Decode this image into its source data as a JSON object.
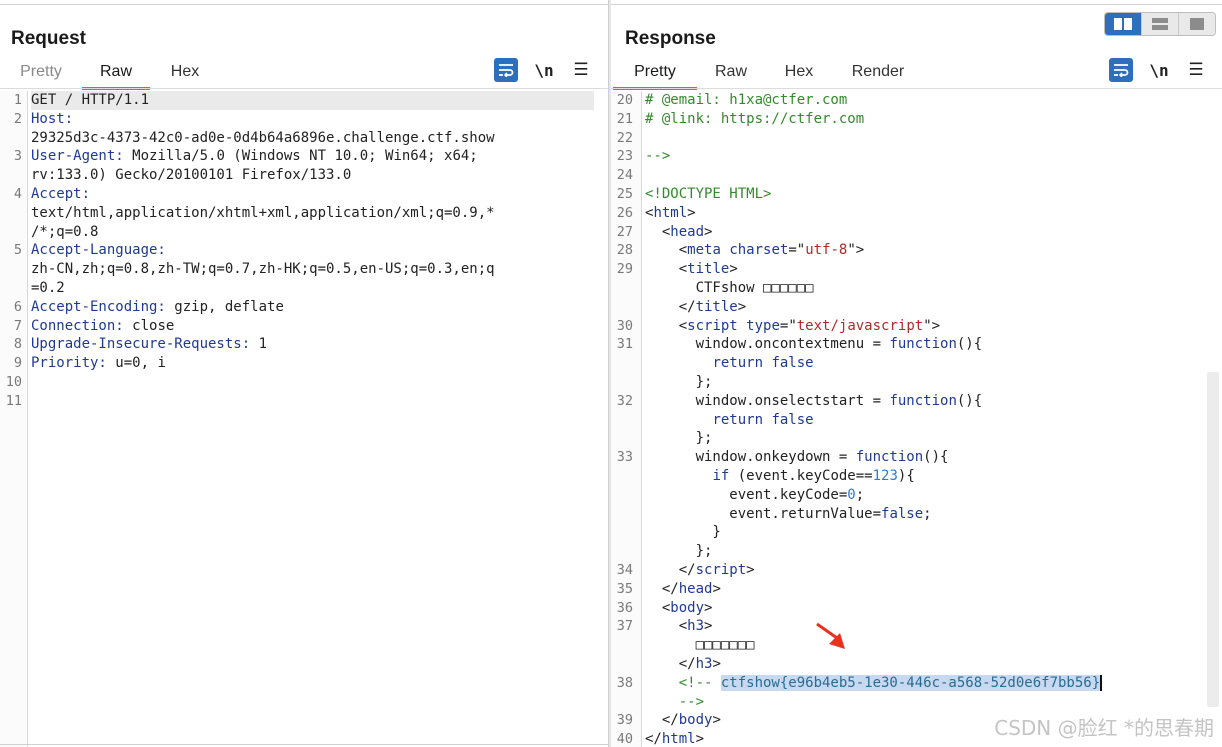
{
  "request": {
    "title": "Request",
    "tabs": [
      "Pretty",
      "Raw",
      "Hex"
    ],
    "active_tab": "Raw",
    "tools": {
      "wrap": "word-wrap-icon",
      "newline_label": "\\n",
      "menu": "menu-icon"
    },
    "lines": [
      {
        "n": "1",
        "segs": [
          {
            "t": "GET / HTTP/1.1",
            "c": ""
          }
        ]
      },
      {
        "n": "2",
        "segs": [
          {
            "t": "Host:",
            "c": "hdr"
          }
        ]
      },
      {
        "n": "",
        "segs": [
          {
            "t": "29325d3c-4373-42c0-ad0e-0d4b64a6896e.challenge.ctf.show",
            "c": ""
          }
        ]
      },
      {
        "n": "3",
        "segs": [
          {
            "t": "User-Agent: ",
            "c": "hdr"
          },
          {
            "t": "Mozilla/5.0 (Windows NT 10.0; Win64; x64;",
            "c": ""
          }
        ]
      },
      {
        "n": "",
        "segs": [
          {
            "t": "rv:133.0) Gecko/20100101 Firefox/133.0",
            "c": ""
          }
        ]
      },
      {
        "n": "4",
        "segs": [
          {
            "t": "Accept:",
            "c": "hdr"
          }
        ]
      },
      {
        "n": "",
        "segs": [
          {
            "t": "text/html,application/xhtml+xml,application/xml;q=0.9,*",
            "c": ""
          }
        ]
      },
      {
        "n": "",
        "segs": [
          {
            "t": "/*;q=0.8",
            "c": ""
          }
        ]
      },
      {
        "n": "5",
        "segs": [
          {
            "t": "Accept-Language:",
            "c": "hdr"
          }
        ]
      },
      {
        "n": "",
        "segs": [
          {
            "t": "zh-CN,zh;q=0.8,zh-TW;q=0.7,zh-HK;q=0.5,en-US;q=0.3,en;q",
            "c": ""
          }
        ]
      },
      {
        "n": "",
        "segs": [
          {
            "t": "=0.2",
            "c": ""
          }
        ]
      },
      {
        "n": "6",
        "segs": [
          {
            "t": "Accept-Encoding: ",
            "c": "hdr"
          },
          {
            "t": "gzip, deflate",
            "c": ""
          }
        ]
      },
      {
        "n": "7",
        "segs": [
          {
            "t": "Connection: ",
            "c": "hdr"
          },
          {
            "t": "close",
            "c": ""
          }
        ]
      },
      {
        "n": "8",
        "segs": [
          {
            "t": "Upgrade-Insecure-Requests: ",
            "c": "hdr"
          },
          {
            "t": "1",
            "c": ""
          }
        ]
      },
      {
        "n": "9",
        "segs": [
          {
            "t": "Priority: ",
            "c": "hdr"
          },
          {
            "t": "u=0, i",
            "c": ""
          }
        ]
      },
      {
        "n": "10",
        "segs": []
      },
      {
        "n": "11",
        "segs": []
      }
    ]
  },
  "response": {
    "title": "Response",
    "tabs": [
      "Pretty",
      "Raw",
      "Hex",
      "Render"
    ],
    "active_tab": "Pretty",
    "tools": {
      "wrap": "word-wrap-icon",
      "newline_label": "\\n",
      "menu": "menu-icon"
    },
    "lines": [
      {
        "n": "20",
        "segs": [
          {
            "t": "# @email: h1xa@ctfer.com",
            "c": "cmt"
          }
        ]
      },
      {
        "n": "21",
        "segs": [
          {
            "t": "# @link: https://ctfer.com",
            "c": "cmt"
          }
        ]
      },
      {
        "n": "22",
        "segs": []
      },
      {
        "n": "23",
        "segs": [
          {
            "t": "-->",
            "c": "cmt"
          }
        ]
      },
      {
        "n": "24",
        "segs": []
      },
      {
        "n": "25",
        "segs": [
          {
            "t": "<!DOCTYPE HTML>",
            "c": "cmt"
          }
        ]
      },
      {
        "n": "26",
        "segs": [
          {
            "t": "<",
            "c": ""
          },
          {
            "t": "html",
            "c": "tag"
          },
          {
            "t": ">",
            "c": ""
          }
        ]
      },
      {
        "n": "27",
        "segs": [
          {
            "t": "  <",
            "c": ""
          },
          {
            "t": "head",
            "c": "tag"
          },
          {
            "t": ">",
            "c": ""
          }
        ]
      },
      {
        "n": "28",
        "segs": [
          {
            "t": "    <",
            "c": ""
          },
          {
            "t": "meta ",
            "c": "tag"
          },
          {
            "t": "charset",
            "c": "attr"
          },
          {
            "t": "=\"",
            "c": ""
          },
          {
            "t": "utf-8",
            "c": "str"
          },
          {
            "t": "\">",
            "c": ""
          }
        ]
      },
      {
        "n": "29",
        "segs": [
          {
            "t": "    <",
            "c": ""
          },
          {
            "t": "title",
            "c": "tag"
          },
          {
            "t": ">",
            "c": ""
          }
        ]
      },
      {
        "n": "",
        "segs": [
          {
            "t": "      CTFshow □□□□□□",
            "c": ""
          }
        ]
      },
      {
        "n": "",
        "segs": [
          {
            "t": "    </",
            "c": ""
          },
          {
            "t": "title",
            "c": "tag"
          },
          {
            "t": ">",
            "c": ""
          }
        ]
      },
      {
        "n": "30",
        "segs": [
          {
            "t": "    <",
            "c": ""
          },
          {
            "t": "script ",
            "c": "tag"
          },
          {
            "t": "type",
            "c": "attr"
          },
          {
            "t": "=\"",
            "c": ""
          },
          {
            "t": "text/javascript",
            "c": "str"
          },
          {
            "t": "\">",
            "c": ""
          }
        ]
      },
      {
        "n": "31",
        "segs": [
          {
            "t": "      window.oncontextmenu = ",
            "c": ""
          },
          {
            "t": "function",
            "c": "kw"
          },
          {
            "t": "(){",
            "c": ""
          }
        ]
      },
      {
        "n": "",
        "segs": [
          {
            "t": "        ",
            "c": ""
          },
          {
            "t": "return false",
            "c": "kw"
          }
        ]
      },
      {
        "n": "",
        "segs": [
          {
            "t": "      };",
            "c": ""
          }
        ]
      },
      {
        "n": "32",
        "segs": [
          {
            "t": "      window.onselectstart = ",
            "c": ""
          },
          {
            "t": "function",
            "c": "kw"
          },
          {
            "t": "(){",
            "c": ""
          }
        ]
      },
      {
        "n": "",
        "segs": [
          {
            "t": "        ",
            "c": ""
          },
          {
            "t": "return false",
            "c": "kw"
          }
        ]
      },
      {
        "n": "",
        "segs": [
          {
            "t": "      };",
            "c": ""
          }
        ]
      },
      {
        "n": "33",
        "segs": [
          {
            "t": "      window.onkeydown = ",
            "c": ""
          },
          {
            "t": "function",
            "c": "kw"
          },
          {
            "t": "(){",
            "c": ""
          }
        ]
      },
      {
        "n": "",
        "segs": [
          {
            "t": "        ",
            "c": ""
          },
          {
            "t": "if",
            "c": "kw"
          },
          {
            "t": " (event.keyCode==",
            "c": ""
          },
          {
            "t": "123",
            "c": "num"
          },
          {
            "t": "){",
            "c": ""
          }
        ]
      },
      {
        "n": "",
        "segs": [
          {
            "t": "          event.keyCode=",
            "c": ""
          },
          {
            "t": "0",
            "c": "num"
          },
          {
            "t": ";",
            "c": ""
          }
        ]
      },
      {
        "n": "",
        "segs": [
          {
            "t": "          event.returnValue=",
            "c": ""
          },
          {
            "t": "false",
            "c": "kw"
          },
          {
            "t": ";",
            "c": ""
          }
        ]
      },
      {
        "n": "",
        "segs": [
          {
            "t": "        }",
            "c": ""
          }
        ]
      },
      {
        "n": "",
        "segs": [
          {
            "t": "      };",
            "c": ""
          }
        ]
      },
      {
        "n": "34",
        "segs": [
          {
            "t": "    </",
            "c": ""
          },
          {
            "t": "script",
            "c": "tag"
          },
          {
            "t": ">",
            "c": ""
          }
        ]
      },
      {
        "n": "35",
        "segs": [
          {
            "t": "  </",
            "c": ""
          },
          {
            "t": "head",
            "c": "tag"
          },
          {
            "t": ">",
            "c": ""
          }
        ]
      },
      {
        "n": "36",
        "segs": [
          {
            "t": "  <",
            "c": ""
          },
          {
            "t": "body",
            "c": "tag"
          },
          {
            "t": ">",
            "c": ""
          }
        ]
      },
      {
        "n": "37",
        "segs": [
          {
            "t": "    <",
            "c": ""
          },
          {
            "t": "h3",
            "c": "tag"
          },
          {
            "t": ">",
            "c": ""
          }
        ]
      },
      {
        "n": "",
        "segs": [
          {
            "t": "      □□□□□□□",
            "c": ""
          }
        ]
      },
      {
        "n": "",
        "segs": [
          {
            "t": "    </",
            "c": ""
          },
          {
            "t": "h3",
            "c": "tag"
          },
          {
            "t": ">",
            "c": ""
          }
        ]
      },
      {
        "n": "38",
        "segs": [
          {
            "t": "    <!-- ",
            "c": "cmt"
          },
          {
            "t": "ctfshow{e96b4eb5-1e30-446c-a568-52d0e6f7bb56}",
            "c": "sel"
          },
          {
            "t": "",
            "c": "caret"
          }
        ]
      },
      {
        "n": "",
        "segs": [
          {
            "t": "    -->",
            "c": "cmt"
          }
        ]
      },
      {
        "n": "39",
        "segs": [
          {
            "t": "  </",
            "c": ""
          },
          {
            "t": "body",
            "c": "tag"
          },
          {
            "t": ">",
            "c": ""
          }
        ]
      },
      {
        "n": "40",
        "segs": [
          {
            "t": "</",
            "c": ""
          },
          {
            "t": "html",
            "c": "tag"
          },
          {
            "t": ">",
            "c": ""
          }
        ]
      }
    ]
  },
  "layout_buttons": [
    "split-horizontal-icon",
    "split-vertical-icon",
    "single-pane-icon"
  ],
  "watermark": "CSDN @脸红   *的思春期",
  "colors": {
    "accent_tab": "#e8573c",
    "tool_blue": "#2d6fbd",
    "header_key": "#1f3a93",
    "comment": "#338a2c",
    "string": "#b02a2a",
    "selection": "#c7d9f0",
    "arrow": "#e8321e"
  }
}
